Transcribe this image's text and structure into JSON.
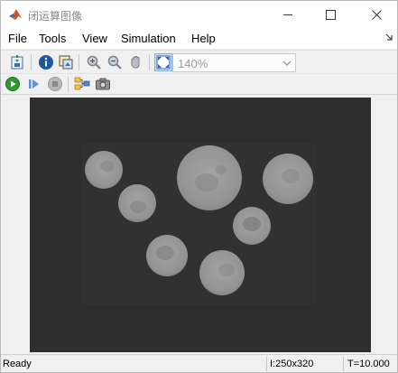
{
  "window": {
    "title": "闭运算图像"
  },
  "menu": {
    "items": [
      "File",
      "Tools",
      "View",
      "Simulation",
      "Help"
    ]
  },
  "toolbar": {
    "zoom_value": "140%"
  },
  "status": {
    "ready": "Ready",
    "image_size": "I:250x320",
    "time": "T=10.000"
  },
  "icons": {
    "app": "matlab-logo-icon",
    "toolbar1": [
      "insert-data-icon",
      "info-icon",
      "export-image-icon",
      "zoom-in-icon",
      "zoom-out-icon",
      "pan-hand-icon",
      "fit-to-view-icon"
    ],
    "toolbar2": [
      "run-icon",
      "step-forward-icon",
      "stop-icon",
      "configure-blocks-icon",
      "snapshot-icon"
    ]
  },
  "colors": {
    "image_background": "#2e2e2e",
    "object_fill": "#9a9a9a",
    "run_green": "#2c9a2c"
  }
}
